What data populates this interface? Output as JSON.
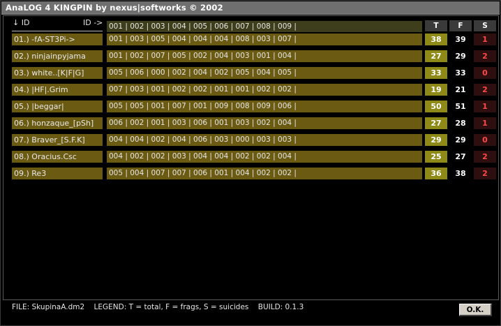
{
  "window": {
    "title": "AnaLOG 4 KINGPIN by  nexus|softworks © 2002"
  },
  "header": {
    "id_label": "↓ ID",
    "id_right_label": "ID ->",
    "ids": "001 | 002 | 003 | 004 | 005 | 006 | 007 | 008 | 009 |",
    "col_t": "T",
    "col_f": "F",
    "col_s": "S"
  },
  "rows": [
    {
      "name": "01.) -fA-ST3Pi->",
      "cells": "001 | 003 | 005 | 004 | 004 | 004 | 008 | 003 | 007 |",
      "t": "38",
      "f": "39",
      "s": "1"
    },
    {
      "name": "02.) ninjainpyjama",
      "cells": "001 | 002 | 007 | 005 | 002 | 004 | 003 | 001 | 004 |",
      "t": "27",
      "f": "29",
      "s": "2"
    },
    {
      "name": "03.) white..[K|F|G]",
      "cells": "005 | 006 | 000 | 002 | 004 | 002 | 005 | 004 | 005 |",
      "t": "33",
      "f": "33",
      "s": "0"
    },
    {
      "name": "04.) |HF|.Grim",
      "cells": "007 | 003 | 001 | 002 | 002 | 001 | 001 | 002 | 002 |",
      "t": "19",
      "f": "21",
      "s": "2"
    },
    {
      "name": "05.) |beggar|",
      "cells": "005 | 005 | 001 | 007 | 001 | 009 | 008 | 009 | 006 |",
      "t": "50",
      "f": "51",
      "s": "1"
    },
    {
      "name": "06.) honzaque_[pSh]",
      "cells": "006 | 002 | 001 | 003 | 006 | 001 | 003 | 002 | 004 |",
      "t": "27",
      "f": "28",
      "s": "1"
    },
    {
      "name": "07.) Braver_[S.F.K]",
      "cells": "004 | 004 | 002 | 004 | 006 | 003 | 000 | 003 | 003 |",
      "t": "29",
      "f": "29",
      "s": "0"
    },
    {
      "name": "08.) Oracius.Csc",
      "cells": "004 | 002 | 002 | 003 | 004 | 004 | 002 | 002 | 004 |",
      "t": "25",
      "f": "27",
      "s": "2"
    },
    {
      "name": "09.) Re3",
      "cells": "005 | 004 | 007 | 007 | 006 | 001 | 004 | 002 | 002 |",
      "t": "36",
      "f": "38",
      "s": "2"
    }
  ],
  "footer": {
    "file": "FILE: SkupinaA.dm2",
    "legend": "LEGEND: T = total, F = frags, S = suicides",
    "build": "BUILD: 0.1.3",
    "ok_label": "O.K."
  }
}
